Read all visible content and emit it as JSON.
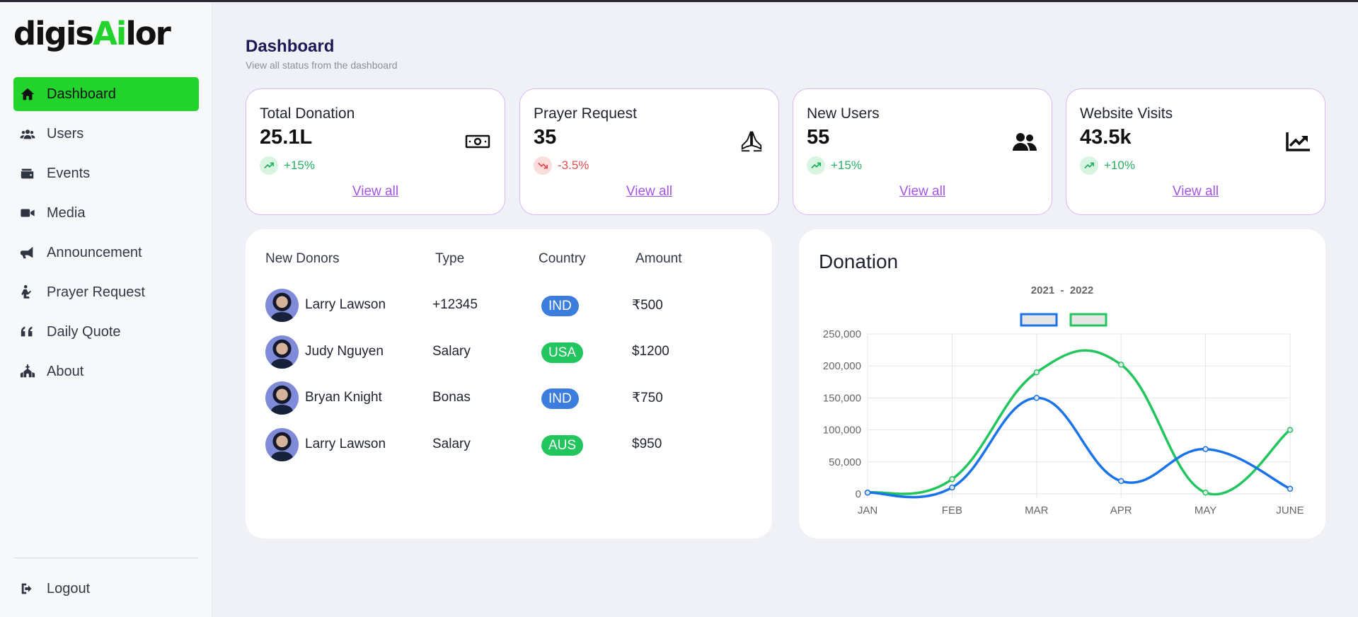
{
  "logo": {
    "pre": "digis",
    "ai": "Ai",
    "post": "lor"
  },
  "sidebar": {
    "items": [
      {
        "label": "Dashboard",
        "icon": "home-icon",
        "active": true
      },
      {
        "label": "Users",
        "icon": "users-icon"
      },
      {
        "label": "Events",
        "icon": "wallet-icon"
      },
      {
        "label": "Media",
        "icon": "video-icon"
      },
      {
        "label": "Announcement",
        "icon": "megaphone-icon"
      },
      {
        "label": "Prayer Request",
        "icon": "praying-icon"
      },
      {
        "label": "Daily Quote",
        "icon": "quote-icon"
      },
      {
        "label": "About",
        "icon": "church-icon"
      }
    ],
    "logout": "Logout"
  },
  "header": {
    "title": "Dashboard",
    "subtitle": "View all status from the dashboard"
  },
  "stats": [
    {
      "label": "Total Donation",
      "value": "25.1L",
      "change": "+15%",
      "direction": "up",
      "icon": "money-bill-icon",
      "link": "View all"
    },
    {
      "label": "Prayer Request",
      "value": "35",
      "change": "-3.5%",
      "direction": "down",
      "icon": "praying-hands-icon",
      "link": "View all"
    },
    {
      "label": "New Users",
      "value": "55",
      "change": "+15%",
      "direction": "up",
      "icon": "user-group-icon",
      "link": "View all"
    },
    {
      "label": "Website Visits",
      "value": "43.5k",
      "change": "+10%",
      "direction": "up",
      "icon": "chart-line-icon",
      "link": "View all"
    }
  ],
  "donors": {
    "columns": [
      "New Donors",
      "Type",
      "Country",
      "Amount"
    ],
    "rows": [
      {
        "name": "Larry Lawson",
        "type": "+12345",
        "country": "IND",
        "amount": "₹500"
      },
      {
        "name": "Judy Nguyen",
        "type": "Salary",
        "country": "USA",
        "amount": "$1200"
      },
      {
        "name": "Bryan Knight",
        "type": "Bonas",
        "country": "IND",
        "amount": "₹750"
      },
      {
        "name": "Larry Lawson",
        "type": "Salary",
        "country": "AUS",
        "amount": "$950"
      }
    ],
    "country_colors": {
      "IND": "#3b7ddd",
      "USA": "#22c55e",
      "AUS": "#22c55e"
    }
  },
  "chart_data": {
    "type": "line",
    "title": "Donation",
    "subtitle": "2021  -  2022",
    "categories": [
      "JAN",
      "FEB",
      "MAR",
      "APR",
      "MAY",
      "JUNE"
    ],
    "series": [
      {
        "values": [
          2000,
          10000,
          150000,
          20000,
          70000,
          8000
        ],
        "color": "#1a73e8"
      },
      {
        "values": [
          2000,
          23000,
          190000,
          202000,
          2000,
          100000
        ],
        "color": "#22c55e"
      }
    ],
    "ylim": [
      0,
      250000
    ],
    "yticks": [
      0,
      50000,
      100000,
      150000,
      200000,
      250000
    ],
    "ytick_labels": [
      "0",
      "50,000",
      "100,000",
      "150,000",
      "200,000",
      "250,000"
    ],
    "grid": true,
    "legend": "top-center"
  }
}
